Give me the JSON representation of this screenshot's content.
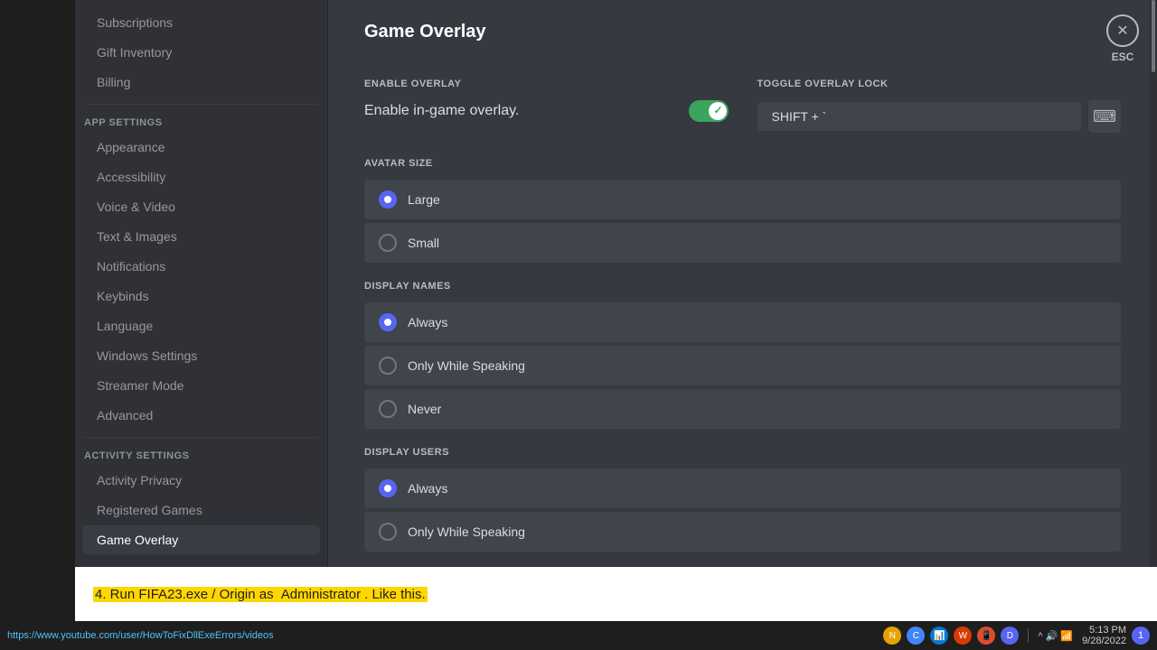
{
  "sidebar": {
    "sections": [
      {
        "items": [
          {
            "id": "subscriptions",
            "label": "Subscriptions",
            "active": false
          },
          {
            "id": "gift-inventory",
            "label": "Gift Inventory",
            "active": false
          },
          {
            "id": "billing",
            "label": "Billing",
            "active": false
          }
        ]
      },
      {
        "header": "APP SETTINGS",
        "items": [
          {
            "id": "appearance",
            "label": "Appearance",
            "active": false
          },
          {
            "id": "accessibility",
            "label": "Accessibility",
            "active": false
          },
          {
            "id": "voice-video",
            "label": "Voice & Video",
            "active": false
          },
          {
            "id": "text-images",
            "label": "Text & Images",
            "active": false
          },
          {
            "id": "notifications",
            "label": "Notifications",
            "active": false
          },
          {
            "id": "keybinds",
            "label": "Keybinds",
            "active": false
          },
          {
            "id": "language",
            "label": "Language",
            "active": false
          },
          {
            "id": "windows-settings",
            "label": "Windows Settings",
            "active": false
          },
          {
            "id": "streamer-mode",
            "label": "Streamer Mode",
            "active": false
          },
          {
            "id": "advanced",
            "label": "Advanced",
            "active": false
          }
        ]
      },
      {
        "header": "ACTIVITY SETTINGS",
        "items": [
          {
            "id": "activity-privacy",
            "label": "Activity Privacy",
            "active": false
          },
          {
            "id": "registered-games",
            "label": "Registered Games",
            "active": false
          },
          {
            "id": "game-overlay",
            "label": "Game Overlay",
            "active": true
          }
        ]
      }
    ]
  },
  "main": {
    "title": "Game Overlay",
    "enable_overlay": {
      "section_label": "ENABLE OVERLAY",
      "toggle_label": "Enable in-game overlay.",
      "toggle_on": true
    },
    "toggle_overlay_lock": {
      "section_label": "TOGGLE OVERLAY LOCK",
      "shortcut": "SHIFT + `",
      "keyboard_icon": "⌨"
    },
    "avatar_size": {
      "section_label": "AVATAR SIZE",
      "options": [
        {
          "id": "large",
          "label": "Large",
          "selected": true
        },
        {
          "id": "small",
          "label": "Small",
          "selected": false
        }
      ]
    },
    "display_names": {
      "section_label": "DISPLAY NAMES",
      "options": [
        {
          "id": "always",
          "label": "Always",
          "selected": true
        },
        {
          "id": "only-while-speaking",
          "label": "Only While Speaking",
          "selected": false
        },
        {
          "id": "never",
          "label": "Never",
          "selected": false
        }
      ]
    },
    "display_users": {
      "section_label": "DISPLAY USERS",
      "options": [
        {
          "id": "always",
          "label": "Always",
          "selected": true
        },
        {
          "id": "only-while-speaking",
          "label": "Only While Speaking",
          "selected": false
        }
      ]
    }
  },
  "esc_label": "ESC",
  "bottom_strip": {
    "text_before": "4. Run FIFA23.exe / Origin as ",
    "highlight": "Administrator",
    "text_after": ". Like this."
  },
  "taskbar": {
    "url": "https://www.youtube.com/user/HowToFixDllExeErrors/videos",
    "time": "5:13 PM",
    "date": "9/28/2022",
    "notification_badge": "1"
  }
}
